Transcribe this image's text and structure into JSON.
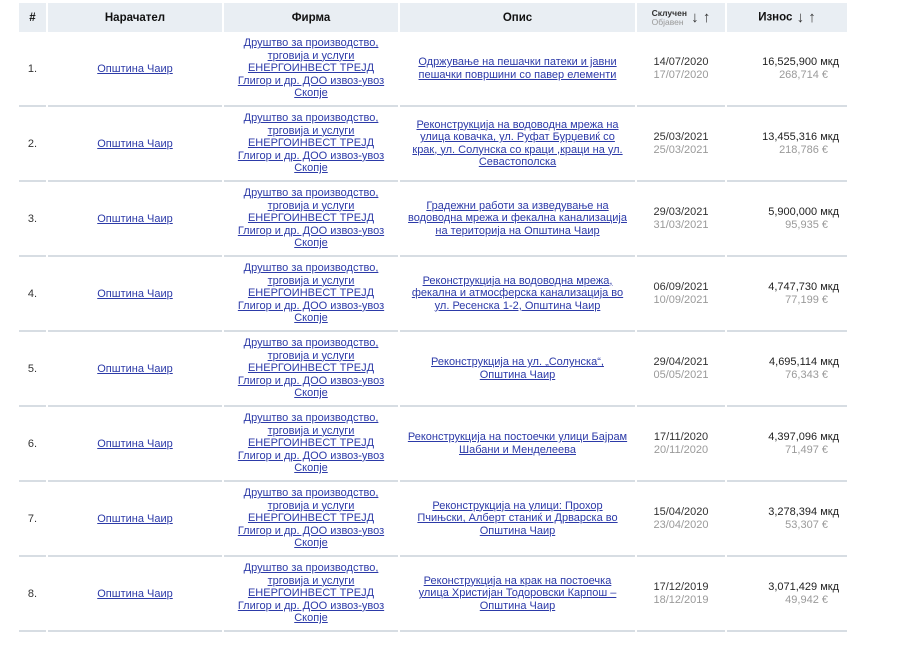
{
  "header": {
    "num": "#",
    "buyer": "Нарачател",
    "firm": "Фирма",
    "description": "Опис",
    "date_top": "Склучен",
    "date_bottom": "Објавен",
    "amount": "Износ",
    "arrow_down": "↓",
    "arrow_up": "↑"
  },
  "rows": [
    {
      "n": "1.",
      "buyer": "Општина Чаир",
      "firm": [
        "Друштво за производство,",
        "трговија и услуги",
        "ЕНЕРГОИНВЕСТ ТРЕЈД",
        "Глигор и др. ДОО извоз-увоз",
        "Скопје"
      ],
      "desc": [
        "Одржување на пешачки патеки и јавни",
        "пешачки површини со павер елементи"
      ],
      "signed": "14/07/2020",
      "published": "17/07/2020",
      "amount": "16,525,900 мкд",
      "eur": "268,714 €"
    },
    {
      "n": "2.",
      "buyer": "Општина Чаир",
      "firm": [
        "Друштво за производство,",
        "трговија и услуги",
        "ЕНЕРГОИНВЕСТ ТРЕЈД",
        "Глигор и др. ДОО извоз-увоз",
        "Скопје"
      ],
      "desc": [
        "Реконструкција на водоводна мрежа на",
        "улица ковачка, ул. Руфат Бурџевиќ со",
        "крак, ул. Солунска со краци ,краци на ул.",
        "Севастополска"
      ],
      "signed": "25/03/2021",
      "published": "25/03/2021",
      "amount": "13,455,316 мкд",
      "eur": "218,786 €"
    },
    {
      "n": "3.",
      "buyer": "Општина Чаир",
      "firm": [
        "Друштво за производство,",
        "трговија и услуги",
        "ЕНЕРГОИНВЕСТ ТРЕЈД",
        "Глигор и др. ДОО извоз-увоз",
        "Скопје"
      ],
      "desc": [
        "Градежни работи за изведување на",
        "водоводна мрежа и фекална канализација",
        "на територија на Општина Чаир"
      ],
      "signed": "29/03/2021",
      "published": "31/03/2021",
      "amount": "5,900,000 мкд",
      "eur": "95,935 €"
    },
    {
      "n": "4.",
      "buyer": "Општина Чаир",
      "firm": [
        "Друштво за производство,",
        "трговија и услуги",
        "ЕНЕРГОИНВЕСТ ТРЕЈД",
        "Глигор и др. ДОО извоз-увоз",
        "Скопје"
      ],
      "desc": [
        "Реконструкција на водоводна мрежа,",
        "фекална и атмосферска канализација во",
        "ул. Ресенска 1-2, Општина Чаир"
      ],
      "signed": "06/09/2021",
      "published": "10/09/2021",
      "amount": "4,747,730 мкд",
      "eur": "77,199 €"
    },
    {
      "n": "5.",
      "buyer": "Општина Чаир",
      "firm": [
        "Друштво за производство,",
        "трговија и услуги",
        "ЕНЕРГОИНВЕСТ ТРЕЈД",
        "Глигор и др. ДОО извоз-увоз",
        "Скопје"
      ],
      "desc": [
        "Реконструкција на ул. „Солунска“,",
        "Општина Чаир"
      ],
      "signed": "29/04/2021",
      "published": "05/05/2021",
      "amount": "4,695,114 мкд",
      "eur": "76,343 €"
    },
    {
      "n": "6.",
      "buyer": "Општина Чаир",
      "firm": [
        "Друштво за производство,",
        "трговија и услуги",
        "ЕНЕРГОИНВЕСТ ТРЕЈД",
        "Глигор и др. ДОО извоз-увоз",
        "Скопје"
      ],
      "desc": [
        "Реконструкција на постоечки улици Бајрам",
        "Шабани и Менделеева"
      ],
      "signed": "17/11/2020",
      "published": "20/11/2020",
      "amount": "4,397,096 мкд",
      "eur": "71,497 €"
    },
    {
      "n": "7.",
      "buyer": "Општина Чаир",
      "firm": [
        "Друштво за производство,",
        "трговија и услуги",
        "ЕНЕРГОИНВЕСТ ТРЕЈД",
        "Глигор и др. ДОО извоз-увоз",
        "Скопје"
      ],
      "desc": [
        "Реконструкција на улици: Прохор",
        "Пчињски, Алберт станиќ и Дрварска во",
        "Општина Чаир"
      ],
      "signed": "15/04/2020",
      "published": "23/04/2020",
      "amount": "3,278,394 мкд",
      "eur": "53,307 €"
    },
    {
      "n": "8.",
      "buyer": "Општина Чаир",
      "firm": [
        "Друштво за производство,",
        "трговија и услуги",
        "ЕНЕРГОИНВЕСТ ТРЕЈД",
        "Глигор и др. ДОО извоз-увоз",
        "Скопје"
      ],
      "desc": [
        "Реконструкција на крак на постоечка",
        "улица Христијан Тодоровски Карпош –",
        "Општина Чаир"
      ],
      "signed": "17/12/2019",
      "published": "18/12/2019",
      "amount": "3,071,429 мкд",
      "eur": "49,942 €"
    }
  ]
}
